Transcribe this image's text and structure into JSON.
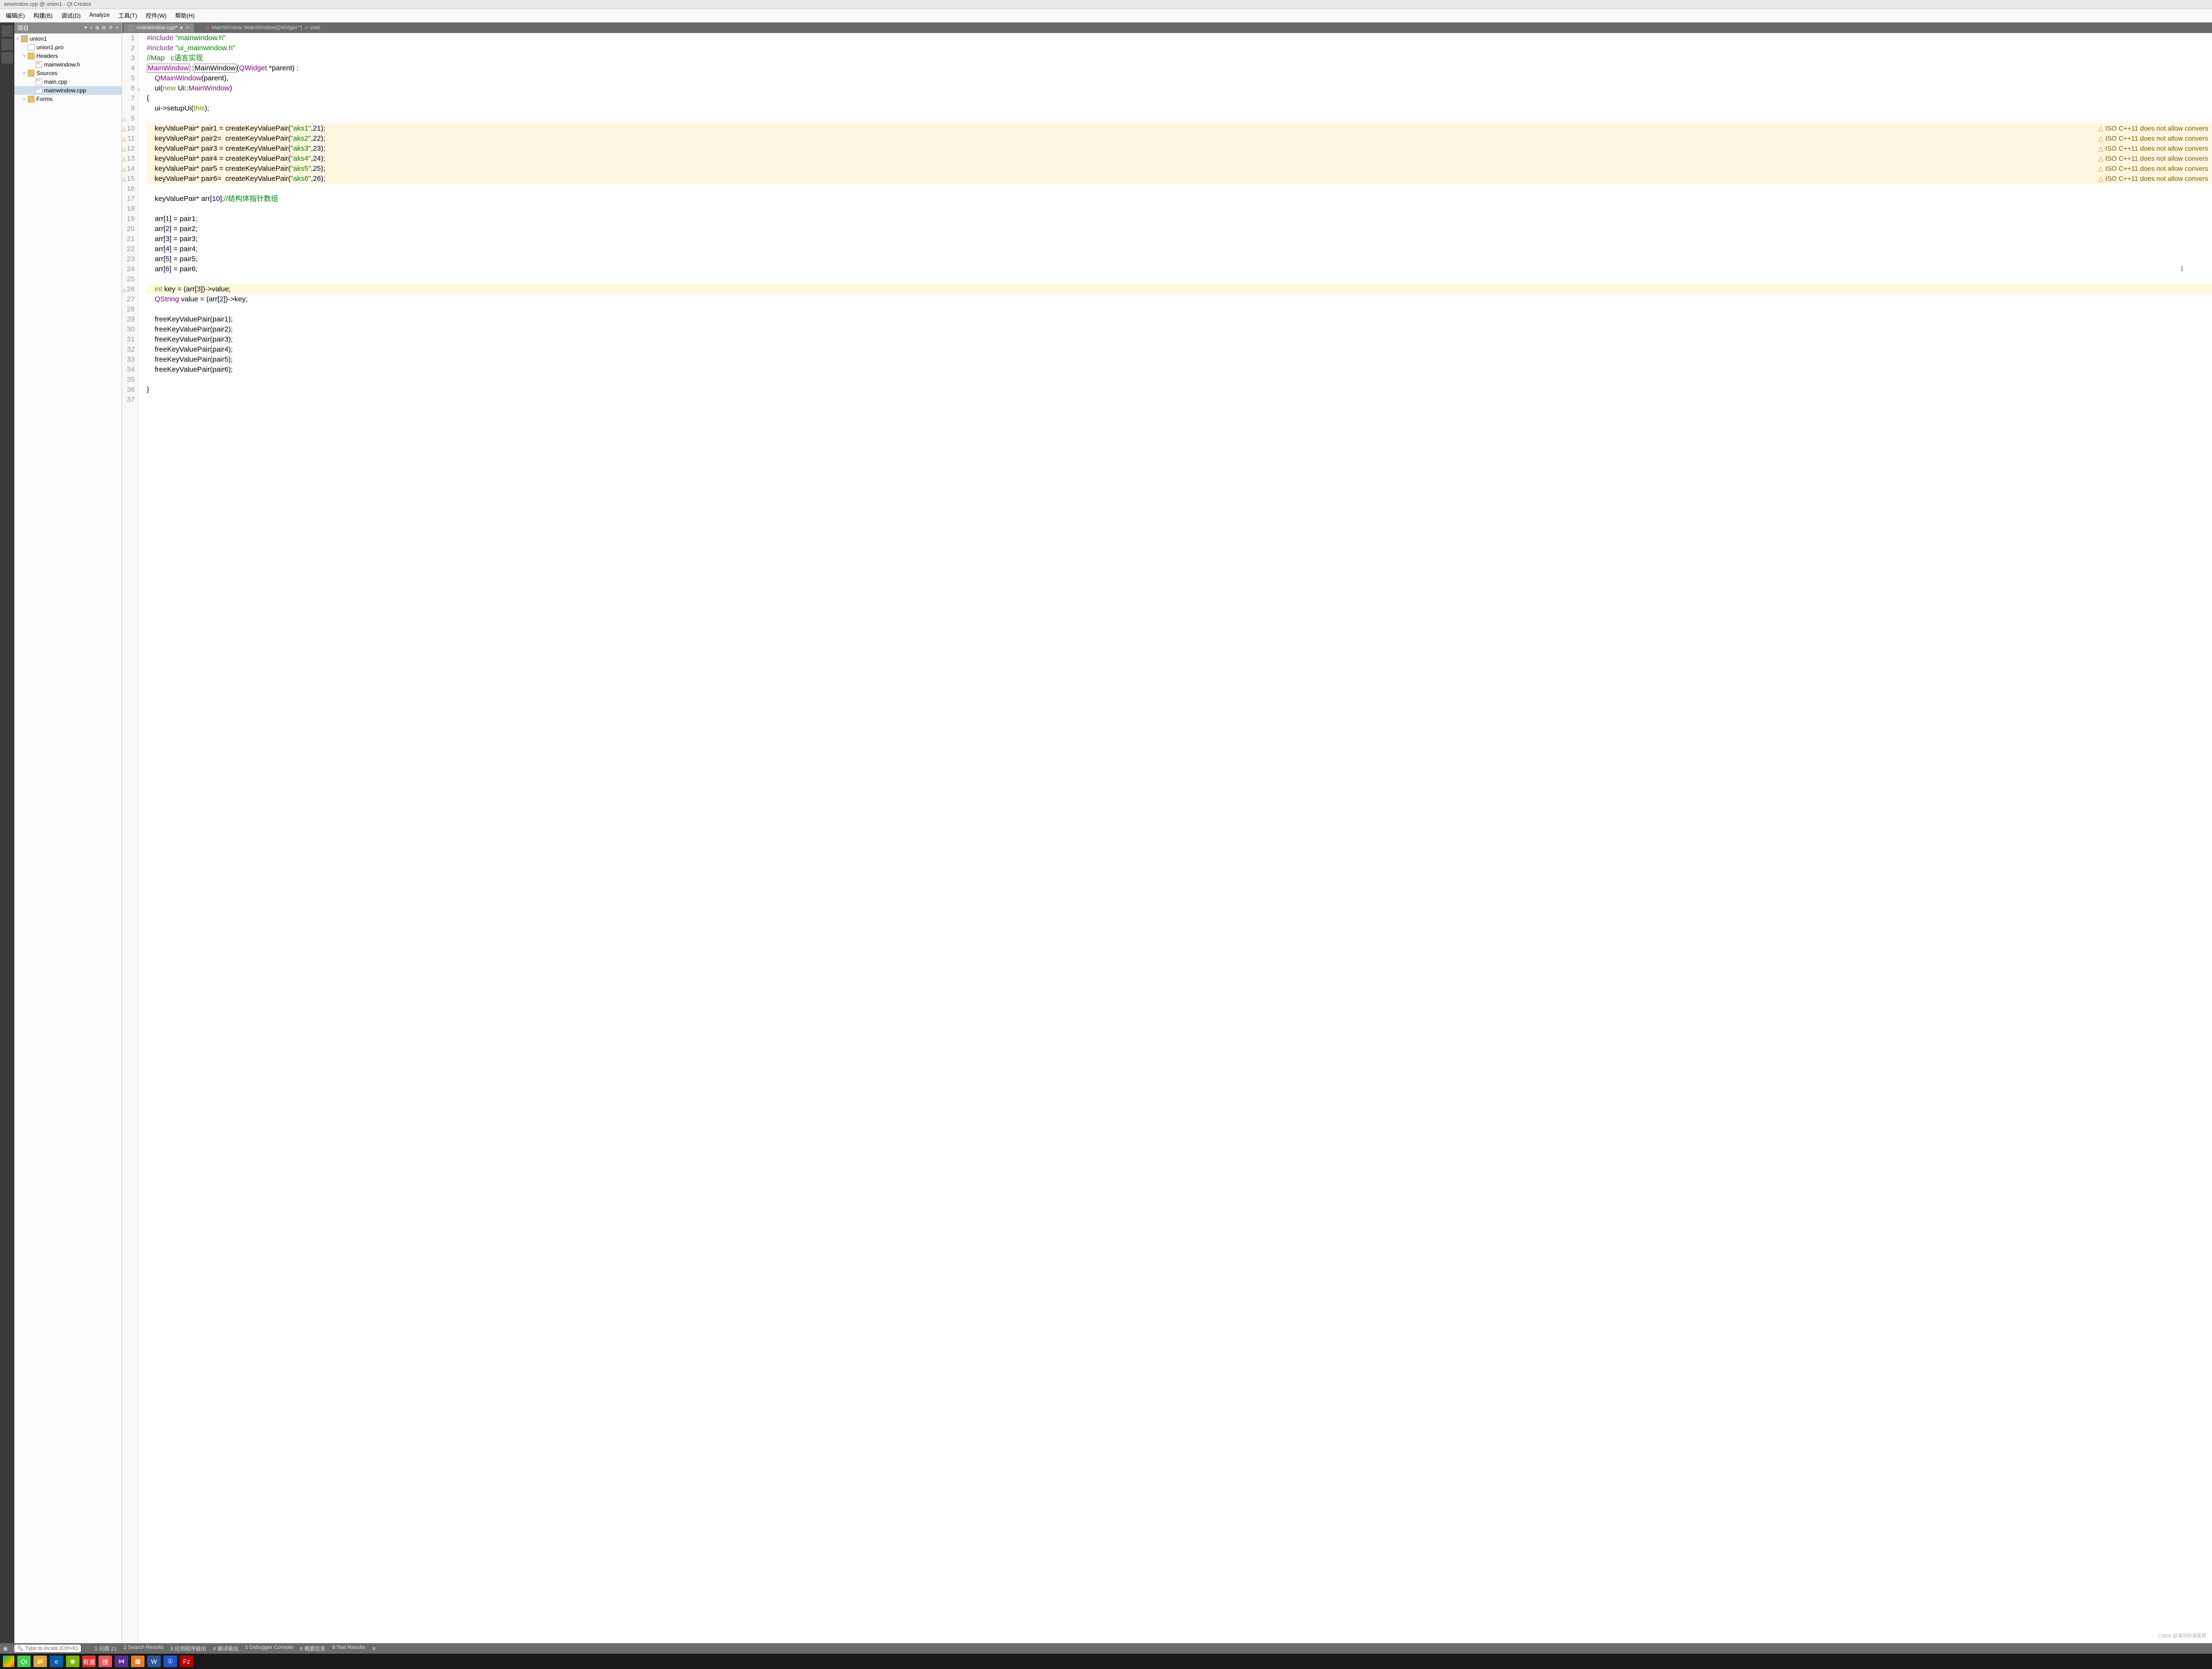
{
  "title": "ainwindow.cpp @ union1 - Qt Creator",
  "menu": [
    "编辑(E)",
    "构建(B)",
    "调试(D)",
    "Analyze",
    "工具(T)",
    "控件(W)",
    "帮助(H)"
  ],
  "panel": {
    "title": "项目",
    "tools": [
      "▾",
      "▿",
      "⊞",
      "⊟",
      "⟳",
      "<"
    ]
  },
  "tree": [
    {
      "depth": 0,
      "arrow": "˅",
      "icon": "proj",
      "label": "union1"
    },
    {
      "depth": 1,
      "arrow": "",
      "icon": "pro",
      "label": "union1.pro"
    },
    {
      "depth": 1,
      "arrow": "˅",
      "icon": "folder",
      "label": "Headers"
    },
    {
      "depth": 2,
      "arrow": "",
      "icon": "h",
      "label": "mainwindow.h"
    },
    {
      "depth": 1,
      "arrow": "˅",
      "icon": "folder",
      "label": "Sources"
    },
    {
      "depth": 2,
      "arrow": "",
      "icon": "cpp",
      "label": "main.cpp"
    },
    {
      "depth": 2,
      "arrow": "",
      "icon": "cpp",
      "label": "mainwindow.cpp",
      "selected": true
    },
    {
      "depth": 1,
      "arrow": ">",
      "icon": "folder",
      "label": "Forms"
    }
  ],
  "editor": {
    "tab": "mainwindow.cpp*",
    "breadcrumb": "MainWindow::MainWindow(QWidget *) -> void"
  },
  "lines": [
    {
      "n": 1,
      "html": "<span class='pp'>#include</span> <span class='str'>\"mainwindow.h\"</span>"
    },
    {
      "n": 2,
      "html": "<span class='pp'>#include</span> <span class='str'>\"ui_mainwindow.h\"</span>"
    },
    {
      "n": 3,
      "html": "<span class='cmt'>//Map   c语言实现</span>"
    },
    {
      "n": 4,
      "html": "<span class='type mw-box'>MainWindow</span>::<span class='fn mw-box'>MainWindow</span>(<span class='type'>QWidget</span> *parent) :"
    },
    {
      "n": 5,
      "html": "    <span class='type'>QMainWindow</span>(parent),"
    },
    {
      "n": 6,
      "fold": true,
      "html": "    ui(<span class='kw'>new</span> Ui::<span class='type'>MainWindow</span>)"
    },
    {
      "n": 7,
      "html": "{"
    },
    {
      "n": 8,
      "html": "    ui-&gt;setupUi(<span class='kw'>this</span>);"
    },
    {
      "n": 9,
      "warn": true,
      "html": ""
    },
    {
      "n": 10,
      "warn": true,
      "warnbg": true,
      "annot": "ISO C++11 does not allow convers",
      "html": "    keyValuePair* pair1 = createKeyValuePair(<span class='str'>\"aks1\"</span>,<span class='num'>21</span>);"
    },
    {
      "n": 11,
      "warn": true,
      "warnbg": true,
      "annot": "ISO C++11 does not allow convers",
      "html": "    keyValuePair* pair2=  createKeyValuePair(<span class='str'>\"aks2\"</span>,<span class='num'>22</span>);"
    },
    {
      "n": 12,
      "warn": true,
      "warnbg": true,
      "annot": "ISO C++11 does not allow convers",
      "html": "    keyValuePair* pair3 = createKeyValuePair(<span class='str'>\"aks3\"</span>,<span class='num'>23</span>);"
    },
    {
      "n": 13,
      "warn": true,
      "warnbg": true,
      "annot": "ISO C++11 does not allow convers",
      "html": "    keyValuePair* pair4 = createKeyValuePair(<span class='str'>\"aks4\"</span>,<span class='num'>24</span>);"
    },
    {
      "n": 14,
      "warn": true,
      "warnbg": true,
      "annot": "ISO C++11 does not allow convers",
      "html": "    keyValuePair* pair5 = createKeyValuePair(<span class='str'>\"aks5\"</span>,<span class='num'>25</span>);"
    },
    {
      "n": 15,
      "warn": true,
      "warnbg": true,
      "annot": "ISO C++11 does not allow convers",
      "html": "    keyValuePair* pair6=  createKeyValuePair(<span class='str'>\"aks6\"</span>,<span class='num'>26</span>);"
    },
    {
      "n": 16,
      "html": ""
    },
    {
      "n": 17,
      "html": "    keyValuePair* arr[<span class='num'>10</span>];<span class='cmt'>//结构体指针数组</span>"
    },
    {
      "n": 18,
      "html": ""
    },
    {
      "n": 19,
      "html": "    arr[<span class='num'>1</span>] = pair1;"
    },
    {
      "n": 20,
      "html": "    arr[<span class='num'>2</span>] = pair2;"
    },
    {
      "n": 21,
      "html": "    arr[<span class='num'>3</span>] = pair3;"
    },
    {
      "n": 22,
      "html": "    arr[<span class='num'>4</span>] = pair4;"
    },
    {
      "n": 23,
      "html": "    arr[<span class='num'>5</span>] = pair5;"
    },
    {
      "n": 24,
      "html": "    arr[<span class='num'>6</span>] = pair6;",
      "caret": true
    },
    {
      "n": 25,
      "html": ""
    },
    {
      "n": 26,
      "warn": true,
      "curbg": true,
      "html": "    <span class='kw'>int</span> key = (arr[<span class='num'>3</span>])-&gt;value;"
    },
    {
      "n": 27,
      "html": "    <span class='type'>QString</span> value = (arr[<span class='num'>2</span>])-&gt;key;"
    },
    {
      "n": 28,
      "html": ""
    },
    {
      "n": 29,
      "html": "    freeKeyValuePair(pair1);"
    },
    {
      "n": 30,
      "html": "    freeKeyValuePair(pair2);"
    },
    {
      "n": 31,
      "html": "    freeKeyValuePair(pair3);"
    },
    {
      "n": 32,
      "html": "    freeKeyValuePair(pair4);"
    },
    {
      "n": 33,
      "html": "    freeKeyValuePair(pair5);"
    },
    {
      "n": 34,
      "html": "    freeKeyValuePair(pair6);"
    },
    {
      "n": 35,
      "html": ""
    },
    {
      "n": 36,
      "html": "}"
    },
    {
      "n": 37,
      "html": ""
    }
  ],
  "status": {
    "locate": "Type to locate (Ctrl+K)",
    "items": [
      {
        "idx": "1",
        "label": "问题",
        "badge": "21"
      },
      {
        "idx": "2",
        "label": "Search Results"
      },
      {
        "idx": "3",
        "label": "应用程序输出"
      },
      {
        "idx": "4",
        "label": "编译输出"
      },
      {
        "idx": "5",
        "label": "Debugger Console"
      },
      {
        "idx": "6",
        "label": "概要信息"
      },
      {
        "idx": "8",
        "label": "Test Results"
      }
    ],
    "expand": "≑"
  },
  "taskbar": [
    {
      "name": "start",
      "bg": ""
    },
    {
      "name": "qt",
      "bg": "#41cd52",
      "txt": "Qt"
    },
    {
      "name": "explorer",
      "bg": "#d9a441",
      "txt": "📁"
    },
    {
      "name": "edge",
      "bg": "#0b5ea5",
      "txt": "e"
    },
    {
      "name": "nvidia",
      "bg": "#76b900",
      "txt": "◉"
    },
    {
      "name": "youdao",
      "bg": "#d33",
      "txt": "有道"
    },
    {
      "name": "sogou",
      "bg": "#e55",
      "txt": "搜"
    },
    {
      "name": "vs",
      "bg": "#5c2d91",
      "txt": "⋈"
    },
    {
      "name": "box",
      "bg": "#e67e22",
      "txt": "▦"
    },
    {
      "name": "word",
      "bg": "#2b579a",
      "txt": "W"
    },
    {
      "name": "app",
      "bg": "#2255cc",
      "txt": "①"
    },
    {
      "name": "filezilla",
      "bg": "#b00",
      "txt": "Fz"
    }
  ],
  "watermark": "CSDN @清风妙语真君"
}
